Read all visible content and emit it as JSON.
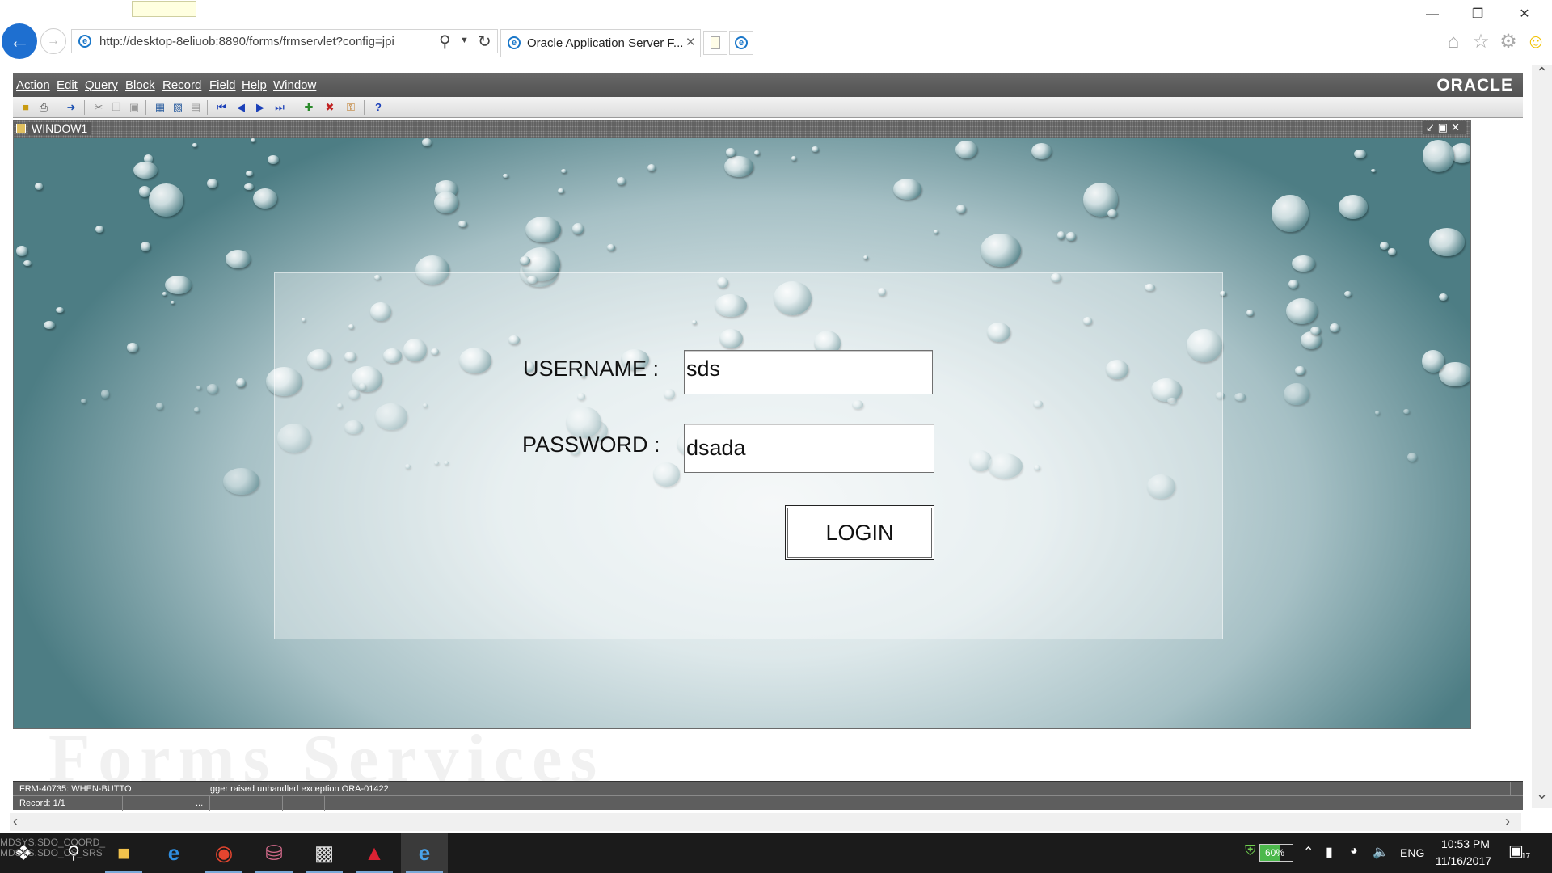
{
  "browser": {
    "address": "http://desktop-8eliuob:8890/forms/frmservlet?config=jpi",
    "tab_title": "Oracle Application Server F...",
    "window_controls": [
      "minimize",
      "restore",
      "close"
    ]
  },
  "app": {
    "menu": [
      "Action",
      "Edit",
      "Query",
      "Block",
      "Record",
      "Field",
      "Help",
      "Window"
    ],
    "brand": "ORACLE",
    "window_title": "WINDOW1",
    "toolbar_icons": [
      "save-icon",
      "print-icon",
      "exit-icon",
      "cut-icon",
      "copy-icon",
      "paste-icon",
      "query-icon",
      "execute-query-icon",
      "cancel-query-icon",
      "first-record-icon",
      "previous-record-icon",
      "next-record-icon",
      "last-record-icon",
      "insert-record-icon",
      "delete-record-icon",
      "lock-record-icon",
      "help-icon"
    ]
  },
  "form": {
    "username_label": "USERNAME :",
    "username_value": "sds",
    "password_label": "PASSWORD :",
    "password_value": "dsada",
    "login_button": "LOGIN"
  },
  "status": {
    "message_prefix": "FRM-40735: WHEN-BUTTO",
    "message_suffix": "gger raised unhandled exception ORA-01422.",
    "record": "Record: 1/1",
    "record_extra": "..."
  },
  "background": {
    "watermark": "Forms Services"
  },
  "taskbar": {
    "ghost_line_1": "MDSYS.SDO_COORD_",
    "ghost_line_2": "MDSYS.SDO_CS_SRS",
    "battery": "60%",
    "language": "ENG",
    "time": "10:53 PM",
    "date": "11/16/2017",
    "notifications": "17"
  },
  "colors": {
    "accent": "#1e6fd0",
    "menubar": "#5a5a5a",
    "taskbar": "#1b1b1b"
  }
}
